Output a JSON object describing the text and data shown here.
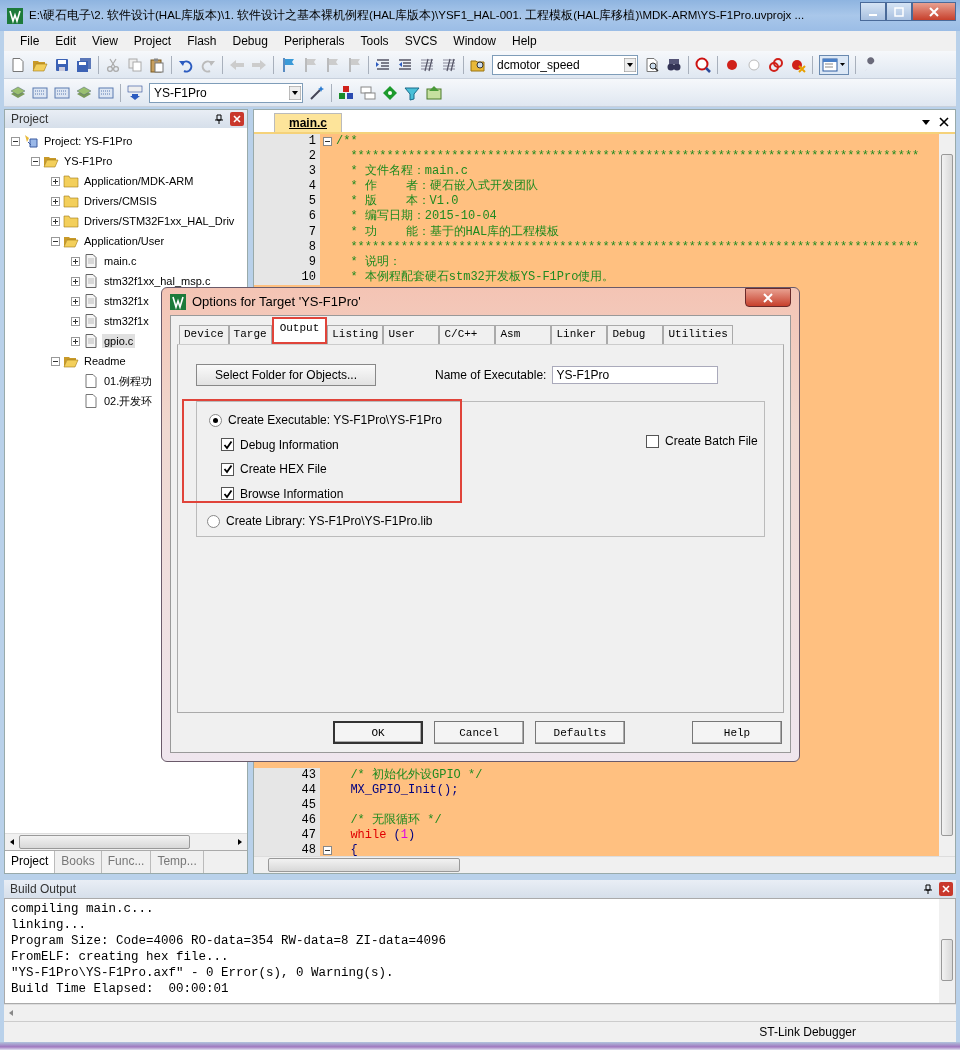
{
  "window": {
    "title": "E:\\硬石电子\\2. 软件设计(HAL库版本)\\1. 软件设计之基本裸机例程(HAL库版本)\\YSF1_HAL-001. 工程模板(HAL库移植)\\MDK-ARM\\YS-F1Pro.uvprojx ..."
  },
  "menu": [
    "File",
    "Edit",
    "View",
    "Project",
    "Flash",
    "Debug",
    "Peripherals",
    "Tools",
    "SVCS",
    "Window",
    "Help"
  ],
  "toolbar": {
    "find_combo": "dcmotor_speed",
    "target_combo": "YS-F1Pro"
  },
  "project_panel": {
    "title": "Project",
    "tree": [
      {
        "label": "Project: YS-F1Pro",
        "kind": "project",
        "expanded": true,
        "selected": false,
        "children": [
          {
            "label": "YS-F1Pro",
            "kind": "target",
            "expanded": true,
            "selected": false,
            "children": [
              {
                "label": "Application/MDK-ARM",
                "kind": "folder",
                "expanded": false,
                "selected": false
              },
              {
                "label": "Drivers/CMSIS",
                "kind": "folder",
                "expanded": false,
                "selected": false
              },
              {
                "label": "Drivers/STM32F1xx_HAL_Driv",
                "kind": "folder",
                "expanded": false,
                "selected": false
              },
              {
                "label": "Application/User",
                "kind": "folder",
                "expanded": true,
                "selected": false,
                "children": [
                  {
                    "label": "main.c",
                    "kind": "source",
                    "expanded": false,
                    "selected": false
                  },
                  {
                    "label": "stm32f1xx_hal_msp.c",
                    "kind": "source",
                    "expanded": false,
                    "selected": false
                  },
                  {
                    "label": "stm32f1x",
                    "kind": "source",
                    "expanded": false,
                    "selected": false
                  },
                  {
                    "label": "stm32f1x",
                    "kind": "source",
                    "expanded": false,
                    "selected": false
                  },
                  {
                    "label": "gpio.c",
                    "kind": "source",
                    "expanded": false,
                    "selected": true
                  }
                ]
              },
              {
                "label": "Readme",
                "kind": "folder",
                "expanded": true,
                "selected": false,
                "children": [
                  {
                    "label": "01.例程功",
                    "kind": "doc",
                    "selected": false
                  },
                  {
                    "label": "02.开发环",
                    "kind": "doc",
                    "selected": false
                  }
                ]
              }
            ]
          }
        ]
      }
    ],
    "tabs": [
      {
        "label": "Project",
        "selected": true
      },
      {
        "label": "Books",
        "selected": false
      },
      {
        "label": "Func...",
        "selected": false
      },
      {
        "label": "Temp...",
        "selected": false
      }
    ]
  },
  "editor": {
    "tab": {
      "label": "main.c",
      "selected": true
    },
    "lines_top": [
      {
        "number": "1",
        "fold": true,
        "segments": [
          {
            "kind": "comment",
            "text": "/**"
          }
        ]
      },
      {
        "number": "2",
        "fold": false,
        "segments": [
          {
            "kind": "comment",
            "text": "  *******************************************************************************"
          }
        ]
      },
      {
        "number": "3",
        "fold": false,
        "segments": [
          {
            "kind": "comment",
            "text": "  * 文件名程：main.c"
          }
        ]
      },
      {
        "number": "4",
        "fold": false,
        "segments": [
          {
            "kind": "comment",
            "text": "  * 作    者：硬石嵌入式开发团队"
          }
        ]
      },
      {
        "number": "5",
        "fold": false,
        "segments": [
          {
            "kind": "comment",
            "text": "  * 版    本：V1.0"
          }
        ]
      },
      {
        "number": "6",
        "fold": false,
        "segments": [
          {
            "kind": "comment",
            "text": "  * 编写日期：2015-10-04"
          }
        ]
      },
      {
        "number": "7",
        "fold": false,
        "segments": [
          {
            "kind": "comment",
            "text": "  * 功    能：基于的HAL库的工程模板"
          }
        ]
      },
      {
        "number": "8",
        "fold": false,
        "segments": [
          {
            "kind": "comment",
            "text": "  *******************************************************************************"
          }
        ]
      },
      {
        "number": "9",
        "fold": false,
        "segments": [
          {
            "kind": "comment",
            "text": "  * 说明："
          }
        ]
      },
      {
        "number": "10",
        "fold": false,
        "segments": [
          {
            "kind": "comment",
            "text": "  * 本例程配套硬石stm32开发板YS-F1Pro使用。"
          }
        ]
      }
    ],
    "lines_bottom": [
      {
        "number": "43",
        "fold": false,
        "segments": [
          {
            "kind": "comment",
            "text": "  /* 初始化外设GPIO */"
          }
        ]
      },
      {
        "number": "44",
        "fold": false,
        "segments": [
          {
            "kind": "plain",
            "text": "  MX_GPIO_Init();"
          }
        ]
      },
      {
        "number": "45",
        "fold": false
      },
      {
        "number": "46",
        "fold": false,
        "segments": [
          {
            "kind": "comment",
            "text": "  /* 无限循环 */"
          }
        ]
      },
      {
        "number": "47",
        "fold": false,
        "segments": [
          {
            "kind": "keyword",
            "text": "  while"
          },
          {
            "kind": "plain",
            "text": " ("
          },
          {
            "kind": "number",
            "text": "1"
          },
          {
            "kind": "plain",
            "text": ")"
          }
        ]
      },
      {
        "number": "48",
        "fold": true,
        "segments": [
          {
            "kind": "plain",
            "text": "  {"
          }
        ]
      }
    ]
  },
  "dialog": {
    "title": "Options for Target 'YS-F1Pro'",
    "tabs": [
      {
        "label": "Device",
        "selected": false,
        "highlighted": false
      },
      {
        "label": "Targe",
        "selected": false,
        "highlighted": false
      },
      {
        "label": "Output",
        "selected": true,
        "highlighted": true
      },
      {
        "label": "Listing",
        "selected": false,
        "highlighted": false
      },
      {
        "label": "User",
        "selected": false,
        "highlighted": false
      },
      {
        "label": "C/C++",
        "selected": false,
        "highlighted": false
      },
      {
        "label": "Asm",
        "selected": false,
        "highlighted": false
      },
      {
        "label": "Linker",
        "selected": false,
        "highlighted": false
      },
      {
        "label": "Debug",
        "selected": false,
        "highlighted": false
      },
      {
        "label": "Utilities",
        "selected": false,
        "highlighted": false
      }
    ],
    "select_folder_button": "Select Folder for Objects...",
    "name_label": "Name of Executable:",
    "name_value": "YS-F1Pro",
    "executable": {
      "label": "Create Executable:  YS-F1Pro\\YS-F1Pro",
      "selected": true,
      "highlighted": true,
      "options": [
        {
          "label": "Debug Information",
          "checked": true
        },
        {
          "label": "Create HEX File",
          "checked": true
        },
        {
          "label": "Browse Information",
          "checked": true
        }
      ]
    },
    "batch_file": {
      "label": "Create Batch File",
      "checked": false
    },
    "library": {
      "label": "Create Library:  YS-F1Pro\\YS-F1Pro.lib",
      "selected": false
    },
    "buttons": [
      "OK",
      "Cancel",
      "Defaults",
      "Help"
    ]
  },
  "build_output": {
    "title": "Build Output",
    "lines": [
      "compiling main.c...",
      "linking...",
      "Program Size: Code=4006 RO-data=354 RW-data=8 ZI-data=4096",
      "FromELF: creating hex file...",
      "\"YS-F1Pro\\YS-F1Pro.axf\" - 0 Error(s), 0 Warning(s).",
      "Build Time Elapsed:  00:00:01"
    ]
  },
  "status_bar": {
    "debugger": "ST-Link Debugger"
  }
}
